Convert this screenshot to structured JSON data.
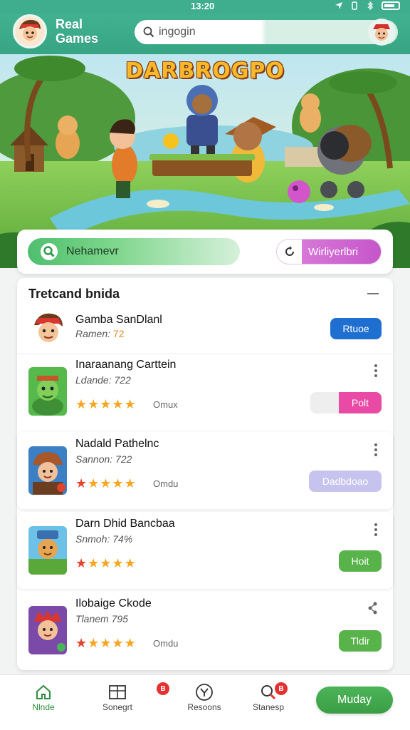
{
  "status_bar": {
    "time": "13:20"
  },
  "header": {
    "title": "Real Games",
    "search_placeholder": "ingogin"
  },
  "banner": {
    "title": "DARBROGPO"
  },
  "actions": {
    "primary_label": "Nehamevr",
    "secondary_label": "Wirliyerlbri"
  },
  "list": {
    "title": "Tretcand bnida",
    "items": [
      {
        "title": "Gamba SanDlanl",
        "subtitle_prefix": "Ramen:",
        "subtitle_value": "72",
        "button": "Rtuoe",
        "button_color": "#1f6fd1",
        "rating": 0
      },
      {
        "title": "Inaraanang Carttein",
        "subtitle": "Ldande: 722",
        "meta": "Omux",
        "button": "Polt",
        "button_color": "#e84aa6",
        "rating": 5,
        "first_star_red": false
      },
      {
        "title": "Nadald Pathelnc",
        "subtitle": "Sannon: 722",
        "meta": "Omdu",
        "button": "Dadbdoao",
        "button_color": "#c7c3ef",
        "rating": 5,
        "first_star_red": true
      },
      {
        "title": "Darn Dhid Bancbaa",
        "subtitle": "Snmoh: 74%",
        "meta": "",
        "button": "Hoit",
        "button_color": "#57b34a",
        "rating": 5,
        "first_star_red": true
      },
      {
        "title": "Ilobaige Ckode",
        "subtitle": "Tlanem 795",
        "meta": "Omdu",
        "button": "Tldir",
        "button_color": "#57b34a",
        "rating": 5,
        "first_star_red": true
      }
    ]
  },
  "bottom_nav": {
    "items": [
      {
        "label": "Nlnde",
        "icon": "home-icon"
      },
      {
        "label": "Sonegrt",
        "icon": "grid-icon",
        "badge": "B"
      },
      {
        "label": "Resoons",
        "icon": "compass-icon"
      },
      {
        "label": "Stanesp",
        "icon": "search-icon",
        "badge": "B"
      }
    ],
    "cta_label": "Muday"
  },
  "colors": {
    "brand_green": "#3fae8f",
    "accent_blue": "#1f6fd1",
    "accent_pink": "#e84aa6",
    "accent_purple": "#c556c9",
    "star_gold": "#f5a623"
  }
}
